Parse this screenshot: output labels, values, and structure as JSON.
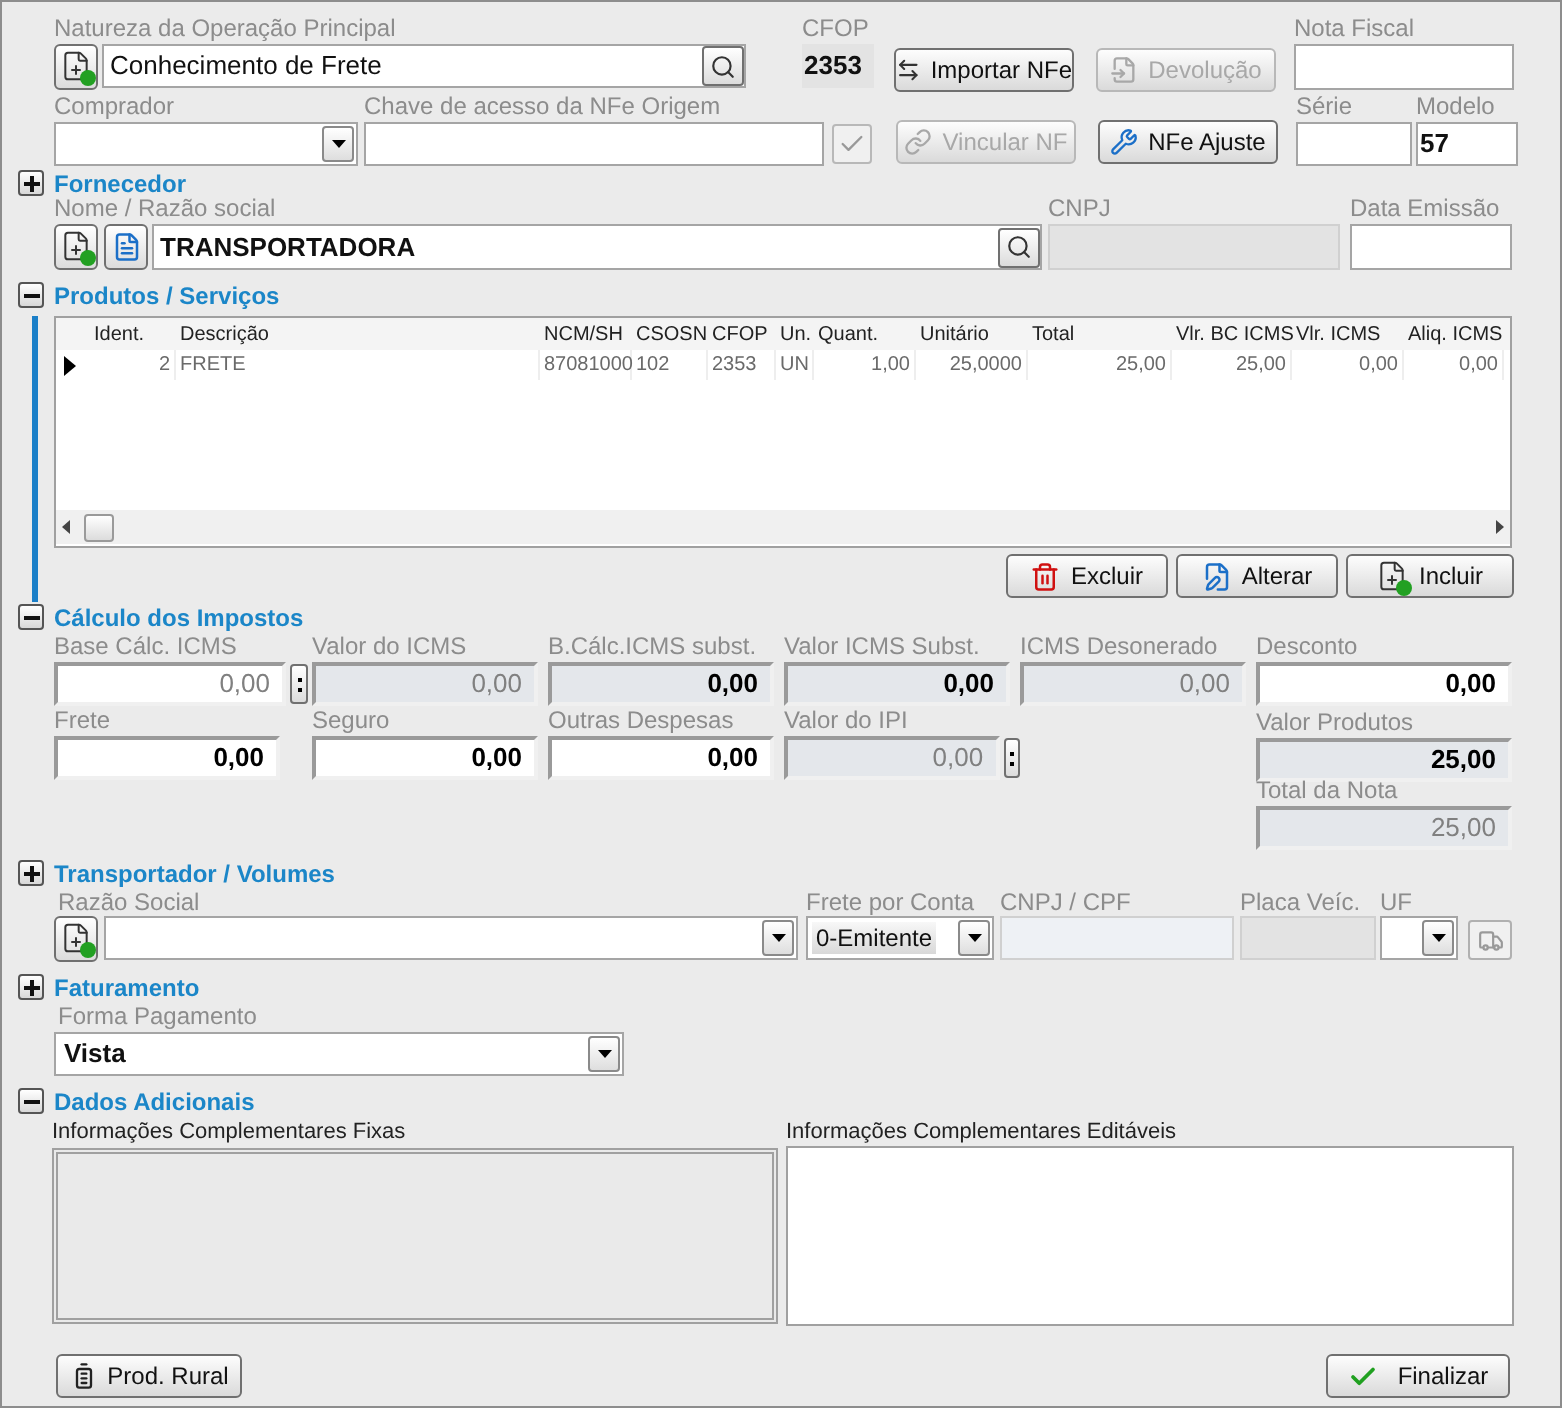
{
  "natureza": {
    "label": "Natureza da Operação Principal",
    "value": "Conhecimento de Frete"
  },
  "cfop": {
    "label": "CFOP",
    "value": "2353"
  },
  "actions": [
    {
      "label": "Importar NFe",
      "disabled": false,
      "kind": "import"
    },
    {
      "label": "Devolução",
      "disabled": true,
      "kind": "return"
    },
    {
      "label": "Vincular NF",
      "disabled": true,
      "kind": "link"
    },
    {
      "label": "NFe Ajuste",
      "disabled": false,
      "kind": "adjust"
    }
  ],
  "nota_fiscal": {
    "label": "Nota Fiscal"
  },
  "comprador": {
    "label": "Comprador"
  },
  "chave": {
    "label": "Chave de acesso da NFe Origem"
  },
  "serie": {
    "label": "Série"
  },
  "modelo": {
    "label": "Modelo",
    "value": "57"
  },
  "fornecedor": {
    "title": "Fornecedor",
    "expanded": false,
    "nome_label": "Nome / Razão social",
    "nome": "TRANSPORTADORA",
    "cnpj_label": "CNPJ",
    "data_label": "Data Emissão"
  },
  "produtos": {
    "title": "Produtos / Serviços",
    "expanded": true,
    "columns": [
      "Ident.",
      "Descrição",
      "NCM/SH",
      "CSOSN",
      "CFOP",
      "Un.",
      "Quant.",
      "Unitário",
      "Total",
      "Vlr. BC ICMS",
      "Vlr. ICMS",
      "Aliq. ICMS"
    ],
    "rows": [
      {
        "selected": true,
        "cells": [
          "2",
          "FRETE",
          "87081000",
          "102",
          "2353",
          "UN",
          "1,00",
          "25,0000",
          "25,00",
          "25,00",
          "0,00",
          "0,00"
        ]
      }
    ],
    "buttons": [
      {
        "label": "Excluir",
        "kind": "delete"
      },
      {
        "label": "Alterar",
        "kind": "edit"
      },
      {
        "label": "Incluir",
        "kind": "add"
      }
    ]
  },
  "impostos": {
    "title": "Cálculo dos Impostos",
    "expanded": true,
    "fields": [
      {
        "label": "Base Cálc. ICMS",
        "value": "0,00",
        "readonly": false,
        "disabled": true,
        "kind": "with-button"
      },
      {
        "label": "Valor do ICMS",
        "value": "0,00",
        "readonly": true,
        "disabled": true,
        "kind": "plain"
      },
      {
        "label": "B.Cálc.ICMS subst.",
        "value": "0,00",
        "readonly": true,
        "disabled": false,
        "kind": "plain"
      },
      {
        "label": "Valor ICMS Subst.",
        "value": "0,00",
        "readonly": true,
        "disabled": false,
        "kind": "plain"
      },
      {
        "label": "ICMS Desonerado",
        "value": "0,00",
        "readonly": true,
        "disabled": true,
        "kind": "plain"
      },
      {
        "label": "Frete",
        "value": "0,00",
        "readonly": false,
        "disabled": false,
        "kind": "plain"
      },
      {
        "label": "Seguro",
        "value": "0,00",
        "readonly": false,
        "disabled": false,
        "kind": "plain"
      },
      {
        "label": "Outras Despesas",
        "value": "0,00",
        "readonly": false,
        "disabled": false,
        "kind": "plain"
      },
      {
        "label": "Valor do IPI",
        "value": "0,00",
        "readonly": true,
        "disabled": true,
        "kind": "with-button"
      }
    ],
    "totals": [
      {
        "label": "Desconto",
        "value": "0,00",
        "readonly": false,
        "disabled": false
      },
      {
        "label": "Valor Produtos",
        "value": "25,00",
        "readonly": true,
        "disabled": false
      },
      {
        "label": "Total da Nota",
        "value": "25,00",
        "readonly": true,
        "disabled": true
      }
    ]
  },
  "transportador": {
    "title": "Transportador / Volumes",
    "expanded": false,
    "razao_label": "Razão Social",
    "frete_label": "Frete por Conta",
    "frete_value": "0-Emitente",
    "cnpj_label": "CNPJ / CPF",
    "placa_label": "Placa Veíc.",
    "uf_label": "UF"
  },
  "faturamento": {
    "title": "Faturamento",
    "expanded": false,
    "forma_label": "Forma Pagamento",
    "forma_value": "Vista"
  },
  "dados": {
    "title": "Dados Adicionais",
    "expanded": true,
    "fixas_label": "Informações Complementares Fixas",
    "editaveis_label": "Informações Complementares Editáveis"
  },
  "footer": {
    "rural": "Prod. Rural",
    "finalizar": "Finalizar"
  }
}
